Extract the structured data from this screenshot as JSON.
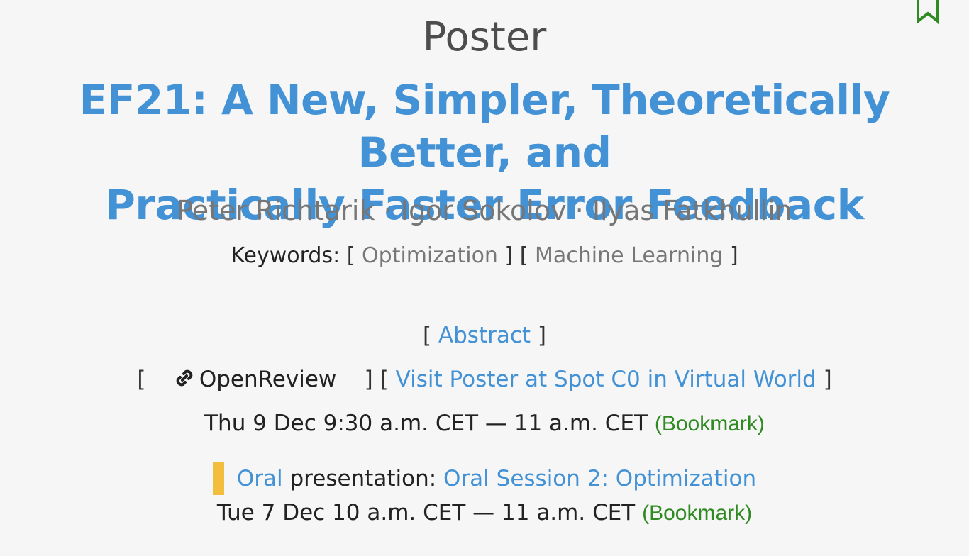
{
  "type_label": "Poster",
  "title_line1": "EF21: A New, Simpler, Theoretically Better, and",
  "title_line2": "Practically Faster Error Feedback",
  "authors": [
    "Peter Richtarik",
    "Igor Sokolov",
    "Ilyas Fatkhullin"
  ],
  "author_separator": " · ",
  "keywords": {
    "label": "Keywords:",
    "items": [
      "Optimization",
      "Machine Learning"
    ]
  },
  "abstract_link": "Abstract",
  "openreview_link": "OpenReview",
  "visit_poster_link": "Visit Poster at Spot C0 in Virtual World",
  "poster_time": "Thu 9 Dec 9:30 a.m. CET — 11 a.m. CET",
  "bookmark_label": "(Bookmark)",
  "oral": {
    "label": "Oral",
    "middle": "presentation:",
    "session": "Oral Session 2: Optimization",
    "time": "Tue 7 Dec 10 a.m. CET — 11 a.m. CET"
  },
  "colors": {
    "accent_blue": "#4392d6",
    "bookmark_green": "#2f8a22",
    "oral_bar": "#f3bd3d"
  }
}
